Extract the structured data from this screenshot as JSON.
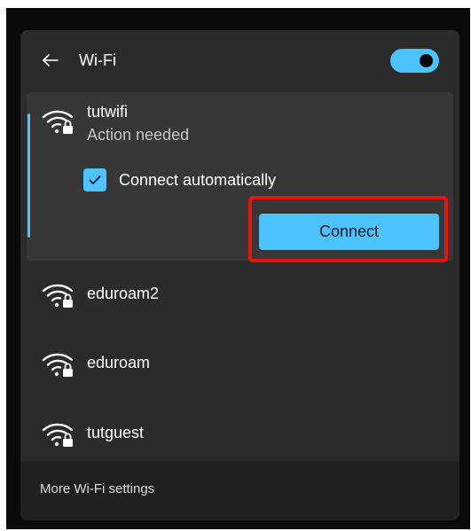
{
  "header": {
    "title": "Wi-Fi",
    "back_icon": "arrow-left-icon",
    "wifi_toggle_on": true
  },
  "selected_network": {
    "name": "tutwifi",
    "status": "Action needed",
    "icon": "wifi-secured-icon",
    "connect_automatically_label": "Connect automatically",
    "connect_automatically_checked": true,
    "connect_button_label": "Connect"
  },
  "networks": [
    {
      "name": "eduroam2",
      "icon": "wifi-secured-icon"
    },
    {
      "name": "eduroam",
      "icon": "wifi-secured-icon"
    },
    {
      "name": "tutguest",
      "icon": "wifi-secured-icon"
    }
  ],
  "footer": {
    "settings_link": "More Wi-Fi settings"
  },
  "colors": {
    "accent": "#4cc2ff",
    "panel_bg": "#2b2b2b",
    "selected_bg": "#373737",
    "highlight": "#e8140c"
  }
}
